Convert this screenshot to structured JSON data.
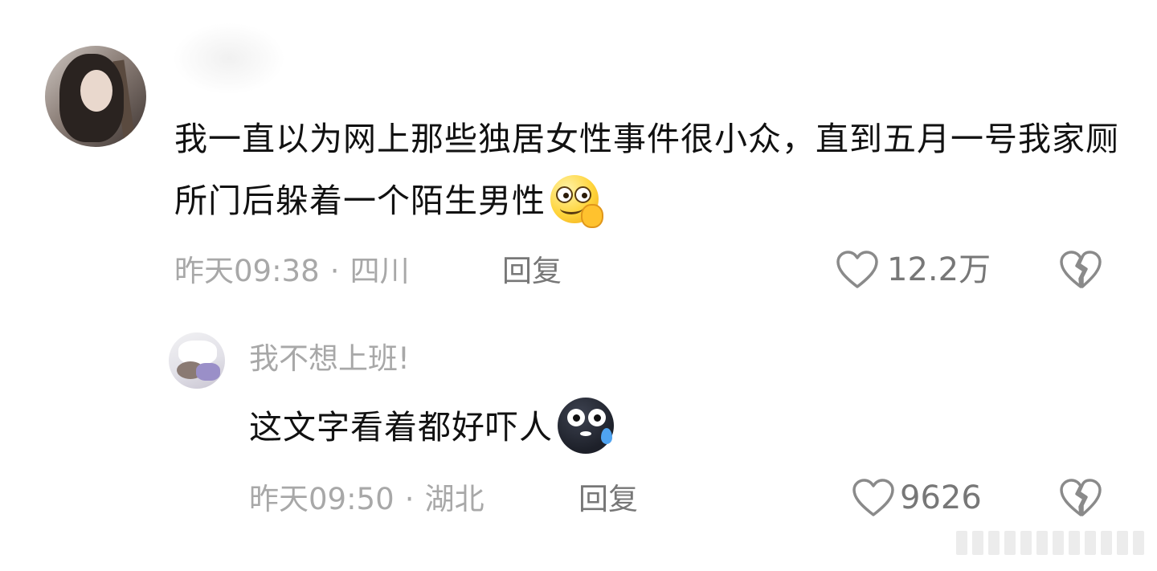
{
  "comment": {
    "text": "我一直以为网上那些独居女性事件很小众，直到五月一号我家厕所门后躲着一个陌生男性",
    "emoji": "smirk-emoji",
    "time": "昨天09:38",
    "separator": "·",
    "location": "四川",
    "reply_label": "回复",
    "like_count": "12.2万"
  },
  "reply": {
    "username": "我不想上班!",
    "text": "这文字看着都好吓人",
    "emoji": "scared-emoji",
    "time": "昨天09:50",
    "separator": "·",
    "location": "湖北",
    "reply_label": "回复",
    "like_count": "9626"
  },
  "colors": {
    "text_primary": "#111111",
    "text_meta": "#a8a8a8",
    "text_secondary": "#777777",
    "background": "#ffffff"
  },
  "icons": {
    "like": "heart-outline-icon",
    "dislike": "broken-heart-icon"
  }
}
